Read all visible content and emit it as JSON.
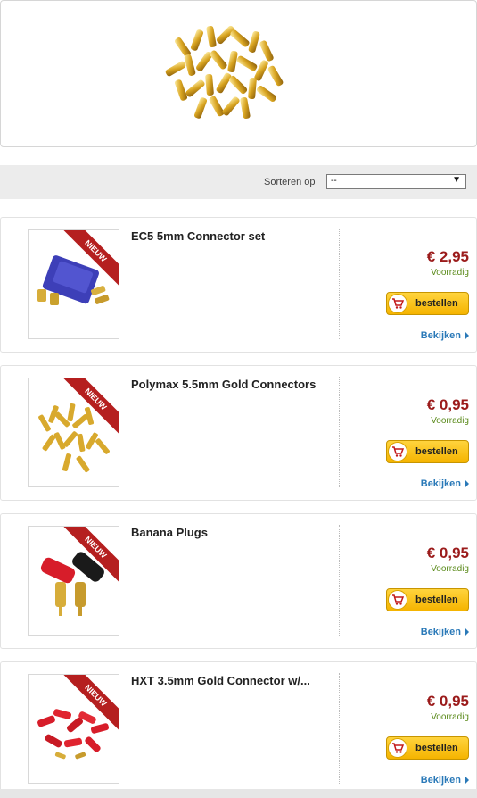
{
  "sort": {
    "label": "Sorteren op",
    "selected": "--"
  },
  "ribbon_label": "NIEUW",
  "order_label": "bestellen",
  "view_label": "Bekijken",
  "products": [
    {
      "title": "EC5 5mm Connector set",
      "price": "€ 2,95",
      "stock": "Voorradig",
      "image": "blue-ec5-connector"
    },
    {
      "title": "Polymax 5.5mm Gold Connectors",
      "price": "€ 0,95",
      "stock": "Voorradig",
      "image": "gold-connectors"
    },
    {
      "title": "Banana Plugs",
      "price": "€ 0,95",
      "stock": "Voorradig",
      "image": "red-black-banana-plugs"
    },
    {
      "title": "HXT 3.5mm Gold Connector w/...",
      "price": "€ 0,95",
      "stock": "Voorradig",
      "image": "red-hxt-connectors"
    }
  ],
  "colors": {
    "price": "#9b1b1b",
    "stock": "#5a8a1a",
    "ribbon": "#b51f1f",
    "link": "#2a79b8",
    "button": "#f5b400"
  }
}
